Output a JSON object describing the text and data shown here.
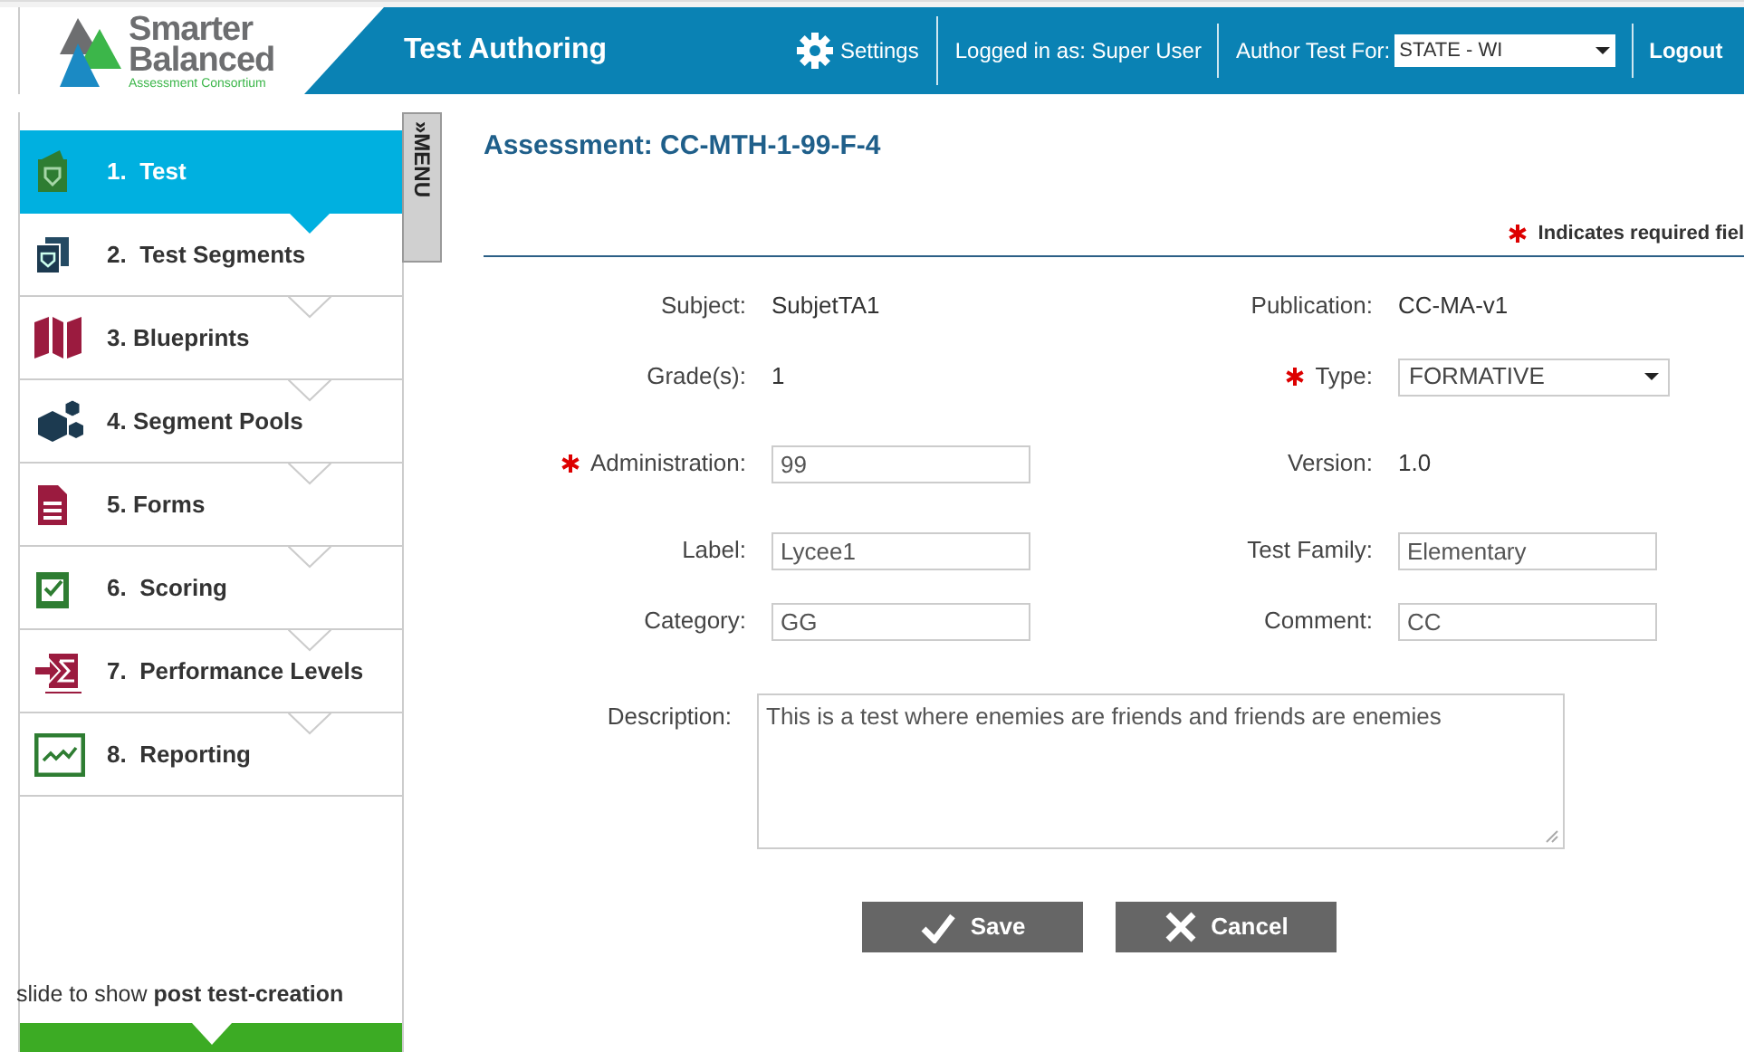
{
  "header": {
    "logo": {
      "line1": "Smarter",
      "line2": "Balanced",
      "tagline": "Assessment Consortium"
    },
    "app_title": "Test Authoring",
    "settings": "Settings",
    "logged_in": "Logged in as: Super User",
    "author_label": "Author Test For:",
    "author_select": "STATE - WI",
    "logout": "Logout"
  },
  "sidebar": {
    "items": [
      {
        "label": "1.  Test",
        "kind": "test",
        "selected": true
      },
      {
        "label": "2.  Test Segments",
        "kind": "segments",
        "selected": false
      },
      {
        "label": "3. Blueprints",
        "kind": "blueprints",
        "selected": false
      },
      {
        "label": "4. Segment Pools",
        "kind": "pools",
        "selected": false
      },
      {
        "label": "5. Forms",
        "kind": "forms",
        "selected": false
      },
      {
        "label": "6.  Scoring",
        "kind": "scoring",
        "selected": false
      },
      {
        "label": "7.  Performance Levels",
        "kind": "performance",
        "selected": false
      },
      {
        "label": "8.  Reporting",
        "kind": "reporting",
        "selected": false
      }
    ],
    "menu_tab": {
      "arrow": "»",
      "label": "MENU"
    },
    "slide_hint": "slide to show **post test-creation**"
  },
  "form": {
    "title": "Assessment: CC-MTH-1-99-F-4",
    "required_note": "Indicates required fiel",
    "rows": [
      {
        "left": {
          "label": "Subject:",
          "value": "SubjetTA1",
          "kind": "static",
          "required": false
        },
        "right": {
          "label": "Publication:",
          "value": "CC-MA-v1",
          "kind": "static",
          "required": false
        }
      },
      {
        "left": {
          "label": "Grade(s):",
          "value": "1",
          "kind": "static",
          "required": false
        },
        "right": {
          "label": "Type:",
          "value": "FORMATIVE",
          "kind": "select",
          "required": true
        }
      },
      {
        "left": {
          "label": "Administration:",
          "value": "99",
          "kind": "input",
          "required": true
        },
        "right": {
          "label": "Version:",
          "value": "1.0",
          "kind": "static",
          "required": false
        }
      },
      {
        "left": {
          "label": "Label:",
          "value": "Lycee1",
          "kind": "input",
          "required": false
        },
        "right": {
          "label": "Test Family:",
          "value": "Elementary",
          "kind": "input",
          "required": false
        }
      },
      {
        "left": {
          "label": "Category:",
          "value": "GG",
          "kind": "input",
          "required": false
        },
        "right": {
          "label": "Comment:",
          "value": "CC",
          "kind": "input",
          "required": false
        }
      }
    ],
    "description": {
      "label": "Description:",
      "value": "This is a test where enemies are friends and friends are enemies"
    },
    "buttons": [
      {
        "label": "Save",
        "kind": "save"
      },
      {
        "label": "Cancel",
        "kind": "cancel"
      }
    ]
  }
}
